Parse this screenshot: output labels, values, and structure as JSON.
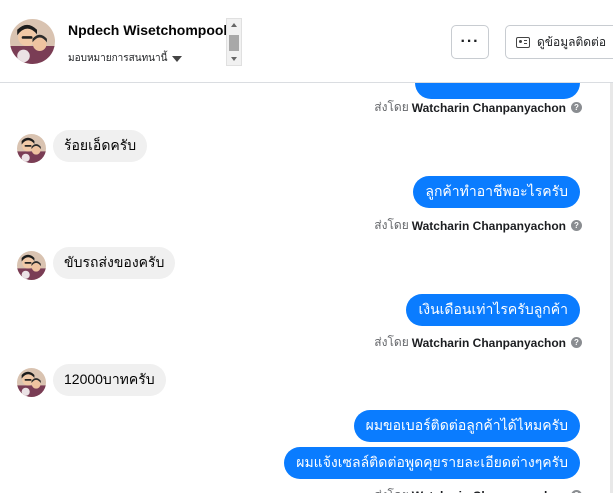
{
  "header": {
    "contact_name": "Npdech Wisetchompooh",
    "assign_label": "มอบหมายการสนทนานี้",
    "more_label": "···",
    "view_contact_label": "ดูข้อมูลติดต่อ"
  },
  "sent_by": {
    "prefix": "ส่งโดย",
    "agent": "Watcharin Chanpanyachon",
    "help_glyph": "?"
  },
  "messages": [
    {
      "dir": "out",
      "text": ""
    },
    {
      "dir": "in",
      "text": "ร้อยเอ็ดครับ"
    },
    {
      "dir": "out",
      "text": "ลูกค้าทำอาชีพอะไรครับ"
    },
    {
      "dir": "in",
      "text": "ขับรถส่งของครับ"
    },
    {
      "dir": "out",
      "text": "เงินเดือนเท่าไรครับลูกค้า"
    },
    {
      "dir": "in",
      "text": "12000บาทครับ"
    },
    {
      "dir": "out",
      "text": "ผมขอเบอร์ติดต่อลูกค้าได้ไหมครับ"
    },
    {
      "dir": "out",
      "text": "ผมแจ้งเซลล์ติดต่อพูดคุยรายละเอียดต่างๆครับ"
    }
  ],
  "colors": {
    "outgoing_bubble": "#0a7cff",
    "incoming_bubble": "#f0f0f0",
    "meta_text": "#65676b"
  }
}
